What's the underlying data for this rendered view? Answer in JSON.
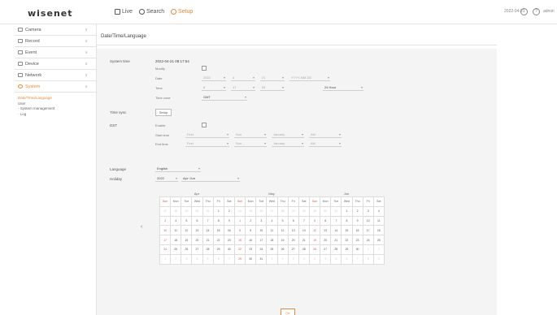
{
  "brand": "wisenet",
  "nav": {
    "live": "Live",
    "search": "Search",
    "setup": "Setup"
  },
  "topright": {
    "datetime": "2022-04-21",
    "help": "?",
    "user": "admin"
  },
  "sidebar": {
    "items": [
      {
        "label": "Camera",
        "chev": "∨"
      },
      {
        "label": "Record",
        "chev": "∨"
      },
      {
        "label": "Event",
        "chev": "∨"
      },
      {
        "label": "Device",
        "chev": "∨"
      },
      {
        "label": "Network",
        "chev": "∨"
      },
      {
        "label": "System",
        "chev": "∧"
      }
    ],
    "sub": [
      "Date/Time/Language",
      "User",
      "· System management",
      "· Log"
    ]
  },
  "page": {
    "title": "Date/Time/Language"
  },
  "form": {
    "system_time": "System time",
    "system_time_value": "2022-04-21 08:17:54",
    "modify": "Modify",
    "date": "Date",
    "year": "2022",
    "month": "4",
    "day": "21",
    "date_format": "YYYY-MM-DD",
    "time": "Time",
    "hour": "8",
    "minute": "17",
    "second": "54",
    "hour_format": "24 Hour",
    "timezone_label": "Time zone",
    "timezone_value": "GMT",
    "time_sync": "Time sync",
    "setup_btn": "Setup",
    "dst": "DST",
    "enable": "Enable",
    "start_time": "Start time",
    "start_week": "First",
    "start_day": "Sun",
    "start_month": "January",
    "start_hour": "AM",
    "end_time": "End time",
    "end_week": "First",
    "end_day": "Sun",
    "end_month": "January",
    "end_hour": "AM",
    "language": "Language",
    "language_value": "English",
    "holiday": "Holiday",
    "holiday_year": "2022",
    "holiday_range": "Apr~Jun",
    "ok": "OK"
  },
  "calendar": {
    "prev": "‹",
    "next": "›",
    "months": [
      {
        "name": "Apr",
        "days": [
          "Sun",
          "Mon",
          "Tue",
          "Wed",
          "Thu",
          "Fri",
          "Sat"
        ],
        "rows": [
          [
            "27",
            "28",
            "29",
            "30",
            "31",
            "1",
            "2"
          ],
          [
            "3",
            "4",
            "5",
            "6",
            "7",
            "8",
            "9"
          ],
          [
            "10",
            "11",
            "12",
            "13",
            "14",
            "15",
            "16"
          ],
          [
            "17",
            "18",
            "19",
            "20",
            "21",
            "22",
            "23"
          ],
          [
            "24",
            "25",
            "26",
            "27",
            "28",
            "29",
            "30"
          ],
          [
            "1",
            "2",
            "3",
            "4",
            "5",
            "6",
            "7"
          ]
        ]
      },
      {
        "name": "May",
        "days": [
          "Sun",
          "Mon",
          "Tue",
          "Wed",
          "Thu",
          "Fri",
          "Sat"
        ],
        "rows": [
          [
            "24",
            "25",
            "26",
            "27",
            "28",
            "29",
            "30"
          ],
          [
            "1",
            "2",
            "3",
            "4",
            "5",
            "6",
            "7"
          ],
          [
            "8",
            "9",
            "10",
            "11",
            "12",
            "13",
            "14"
          ],
          [
            "15",
            "16",
            "17",
            "18",
            "19",
            "20",
            "21"
          ],
          [
            "22",
            "23",
            "24",
            "25",
            "26",
            "27",
            "28"
          ],
          [
            "29",
            "30",
            "31",
            "1",
            "2",
            "3",
            "4"
          ]
        ]
      },
      {
        "name": "Jun",
        "days": [
          "Sun",
          "Mon",
          "Tue",
          "Wed",
          "Thu",
          "Fri",
          "Sat"
        ],
        "rows": [
          [
            "29",
            "30",
            "31",
            "1",
            "2",
            "3",
            "4"
          ],
          [
            "5",
            "6",
            "7",
            "8",
            "9",
            "10",
            "11"
          ],
          [
            "12",
            "13",
            "14",
            "15",
            "16",
            "17",
            "18"
          ],
          [
            "19",
            "20",
            "21",
            "22",
            "23",
            "24",
            "25"
          ],
          [
            "26",
            "27",
            "28",
            "29",
            "30",
            "1",
            "2"
          ],
          [
            "3",
            "4",
            "5",
            "6",
            "7",
            "8",
            "9"
          ]
        ]
      }
    ]
  },
  "colors": {
    "accent": "#e8893a",
    "border": "#e3e3e3",
    "panel": "#f4f4f4"
  }
}
